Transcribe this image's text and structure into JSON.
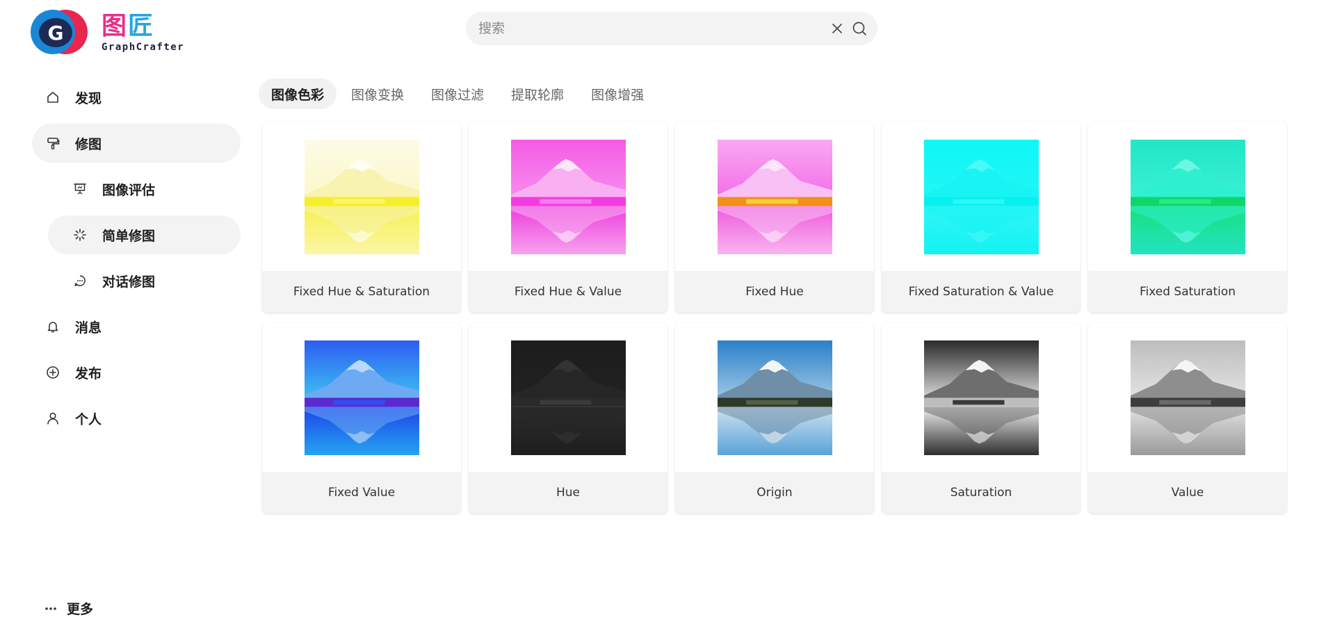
{
  "logo": {
    "mark_letter": "G",
    "cn_1": "图",
    "cn_2": "匠",
    "en": "GraphCrafter"
  },
  "search": {
    "placeholder": "搜索",
    "value": ""
  },
  "sidebar": {
    "items": [
      {
        "label": "发现",
        "icon": "home-icon",
        "active": false,
        "sub": false
      },
      {
        "label": "修图",
        "icon": "paint-roller-icon",
        "active": true,
        "sub": false
      },
      {
        "label": "图像评估",
        "icon": "presentation-icon",
        "active": false,
        "sub": true
      },
      {
        "label": "简单修图",
        "icon": "sparkle-icon",
        "active": true,
        "sub": true
      },
      {
        "label": "对话修图",
        "icon": "chat-bubble-icon",
        "active": false,
        "sub": true
      },
      {
        "label": "消息",
        "icon": "bell-icon",
        "active": false,
        "sub": false
      },
      {
        "label": "发布",
        "icon": "plus-circle-icon",
        "active": false,
        "sub": false
      },
      {
        "label": "个人",
        "icon": "user-icon",
        "active": false,
        "sub": false
      }
    ],
    "more_label": "更多"
  },
  "tabs": [
    {
      "label": "图像色彩",
      "active": true
    },
    {
      "label": "图像变换",
      "active": false
    },
    {
      "label": "图像过滤",
      "active": false
    },
    {
      "label": "提取轮廓",
      "active": false
    },
    {
      "label": "图像增强",
      "active": false
    }
  ],
  "cards": [
    {
      "title": "Fixed Hue & Saturation",
      "style": "fixed-hue-sat"
    },
    {
      "title": "Fixed Hue & Value",
      "style": "fixed-hue-val"
    },
    {
      "title": "Fixed Hue",
      "style": "fixed-hue"
    },
    {
      "title": "Fixed Saturation & Value",
      "style": "fixed-sat-val"
    },
    {
      "title": "Fixed Saturation",
      "style": "fixed-sat"
    },
    {
      "title": "Fixed Value",
      "style": "fixed-val"
    },
    {
      "title": "Hue",
      "style": "hue"
    },
    {
      "title": "Origin",
      "style": "origin"
    },
    {
      "title": "Saturation",
      "style": "saturation"
    },
    {
      "title": "Value",
      "style": "value"
    }
  ]
}
